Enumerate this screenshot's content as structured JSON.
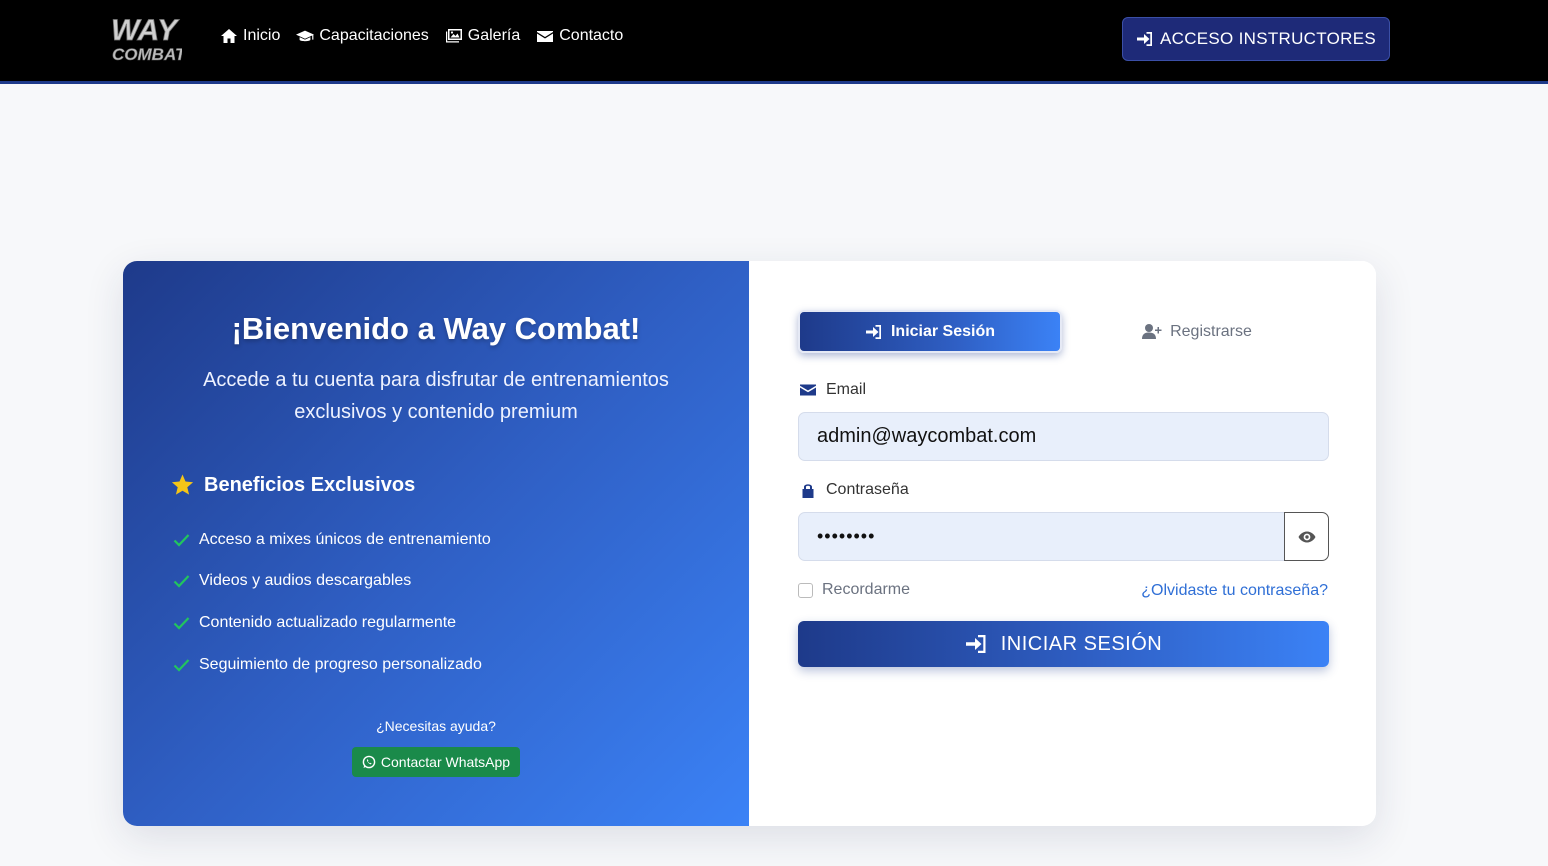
{
  "navbar": {
    "logo_text": "WAY COMBAT",
    "links": [
      {
        "label": "Inicio",
        "icon": "home-icon"
      },
      {
        "label": "Capacitaciones",
        "icon": "graduation-cap-icon"
      },
      {
        "label": "Galería",
        "icon": "images-icon"
      },
      {
        "label": "Contacto",
        "icon": "envelope-icon"
      }
    ],
    "instructors_button": "ACCESO INSTRUCTORES"
  },
  "welcome": {
    "title": "¡Bienvenido a Way Combat!",
    "subtitle": "Accede a tu cuenta para disfrutar de entrenamientos exclusivos y contenido premium",
    "benefits_title": "Beneficios Exclusivos",
    "benefits": [
      "Acceso a mixes únicos de entrenamiento",
      "Videos y audios descargables",
      "Contenido actualizado regularmente",
      "Seguimiento de progreso personalizado"
    ],
    "help_text": "¿Necesitas ayuda?",
    "whatsapp_button": "Contactar WhatsApp"
  },
  "form": {
    "tabs": {
      "login": "Iniciar Sesión",
      "register": "Registrarse"
    },
    "email_label": "Email",
    "email_value": "admin@waycombat.com",
    "password_label": "Contraseña",
    "password_value": "••••••••",
    "remember_label": "Recordarme",
    "forgot_link": "¿Olvidaste tu contraseña?",
    "submit_button": "INICIAR SESIÓN"
  },
  "colors": {
    "primary": "#1e3a8a",
    "accent": "#3b82f6",
    "whatsapp": "#1a8a4a",
    "link": "#2f6fd6"
  }
}
